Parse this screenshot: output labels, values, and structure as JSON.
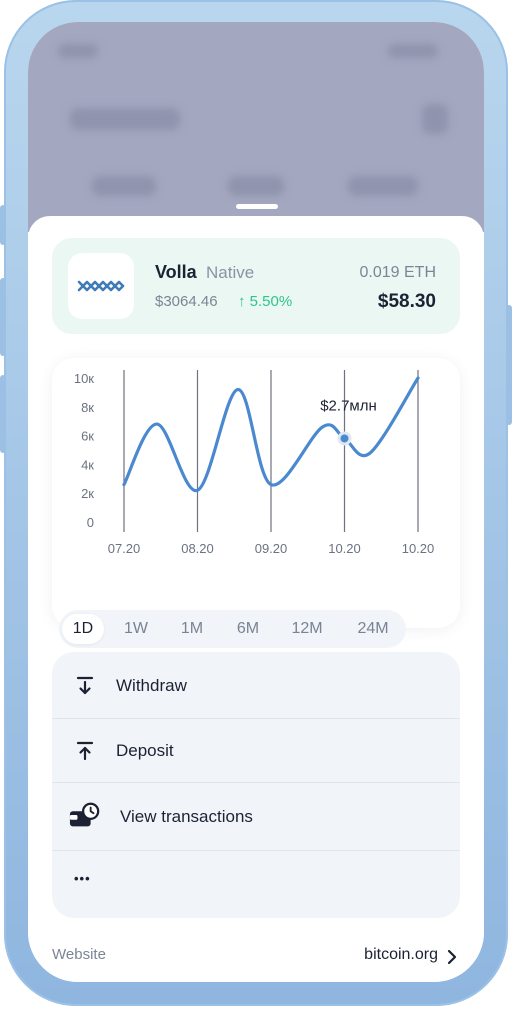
{
  "asset": {
    "name": "Volla",
    "type": "Native",
    "price": "$3064.46",
    "change": "↑ 5.50%",
    "amount": "0.019 ETH",
    "value": "$58.30",
    "logo_icon": "volla-wave-logo-icon"
  },
  "chart_data": {
    "type": "line",
    "x_ticks": [
      "07.20",
      "08.20",
      "09.20",
      "10.20",
      "10.20"
    ],
    "y_ticks": [
      "0",
      "2к",
      "4к",
      "6к",
      "8к",
      "10к"
    ],
    "ylim": [
      0,
      10000
    ],
    "series": [
      {
        "values": [
          {
            "x": 0.0,
            "y": 2600
          },
          {
            "x": 0.45,
            "y": 6800
          },
          {
            "x": 1.0,
            "y": 2200
          },
          {
            "x": 1.55,
            "y": 9200
          },
          {
            "x": 2.0,
            "y": 2600
          },
          {
            "x": 2.7,
            "y": 6600
          },
          {
            "x": 3.0,
            "y": 5800
          },
          {
            "x": 3.35,
            "y": 4800
          },
          {
            "x": 4.0,
            "y": 10000
          }
        ]
      }
    ],
    "annotation": {
      "label": "$2.7млн",
      "x": 3.0,
      "y": 5800
    },
    "line_color": "#4a88cf",
    "grid": "vertical"
  },
  "ranges": {
    "items": [
      "1D",
      "1W",
      "1M",
      "6M",
      "12M",
      "24M"
    ],
    "selected": "1D"
  },
  "actions": [
    {
      "label": "Withdraw",
      "icon": "withdraw-arrow-down-icon"
    },
    {
      "label": "Deposit",
      "icon": "deposit-arrow-up-icon"
    },
    {
      "label": "View transactions",
      "icon": "wallet-clock-icon"
    },
    {
      "label": "•••",
      "icon": "more-dots-icon"
    }
  ],
  "footer": {
    "label": "Website",
    "link": "bitcoin.org",
    "chevron_icon": "chevron-right-icon"
  },
  "colors": {
    "accent_positive": "#30c48d",
    "card_mint": "#eaf7f2",
    "chart_line": "#4a88cf"
  }
}
